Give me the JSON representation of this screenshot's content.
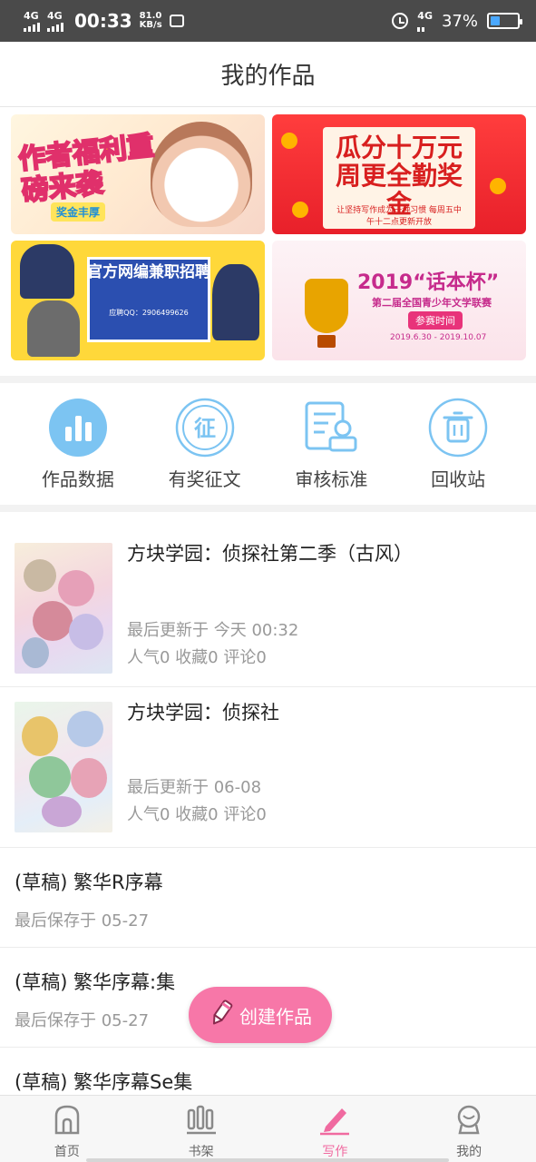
{
  "status_bar": {
    "network1": "4G",
    "network2": "4G",
    "time": "00:33",
    "speed_value": "81.0",
    "speed_unit": "KB/s",
    "network3": "4G",
    "battery_pct": "37%",
    "battery_level": 0.37
  },
  "header": {
    "title": "我的作品"
  },
  "banners": [
    {
      "text": "作者福利重磅来袭",
      "sub": "奖金丰厚"
    },
    {
      "text": "瓜分十万元周更全勤奖金",
      "sub": "让坚持写作成为一种习惯 每周五中午十二点更新开放"
    },
    {
      "text": "官方网编兼职招聘",
      "sub": "应聘QQ：2906499626"
    },
    {
      "text": "2019“话本杯”",
      "sub": "第二届全国青少年文学联赛",
      "tag": "参赛时间",
      "date": "2019.6.30 - 2019.10.07"
    }
  ],
  "tools": [
    {
      "label": "作品数据",
      "icon": "bar-chart-icon"
    },
    {
      "label": "有奖征文",
      "icon": "zheng-badge-icon"
    },
    {
      "label": "审核标准",
      "icon": "review-doc-icon"
    },
    {
      "label": "回收站",
      "icon": "trash-icon"
    }
  ],
  "works": [
    {
      "title": "方块学园：侦探社第二季（古风）",
      "updated": "最后更新于 今天 00:32",
      "stats": "人气0 收藏0 评论0"
    },
    {
      "title": "方块学园：侦探社",
      "updated": "最后更新于 06-08",
      "stats": "人气0 收藏0 评论0"
    }
  ],
  "drafts": [
    {
      "title": "(草稿) 繁华R序幕",
      "saved": "最后保存于 05-27"
    },
    {
      "title": "(草稿) 繁华序幕:集",
      "saved": "最后保存于 05-27"
    },
    {
      "title": "(草稿) 繁华序幕Se集",
      "saved": ""
    }
  ],
  "fab": {
    "label": "创建作品",
    "icon": "pencil-icon"
  },
  "bottom_nav": [
    {
      "label": "首页",
      "icon": "home-icon"
    },
    {
      "label": "书架",
      "icon": "bookshelf-icon"
    },
    {
      "label": "写作",
      "icon": "pen-icon",
      "active": true
    },
    {
      "label": "我的",
      "icon": "profile-icon"
    }
  ],
  "colors": {
    "accent_pink": "#f06aa0",
    "fab_pink": "#f777a8",
    "icon_blue": "#7cc4f2",
    "status_bar": "#4a4a4a"
  }
}
